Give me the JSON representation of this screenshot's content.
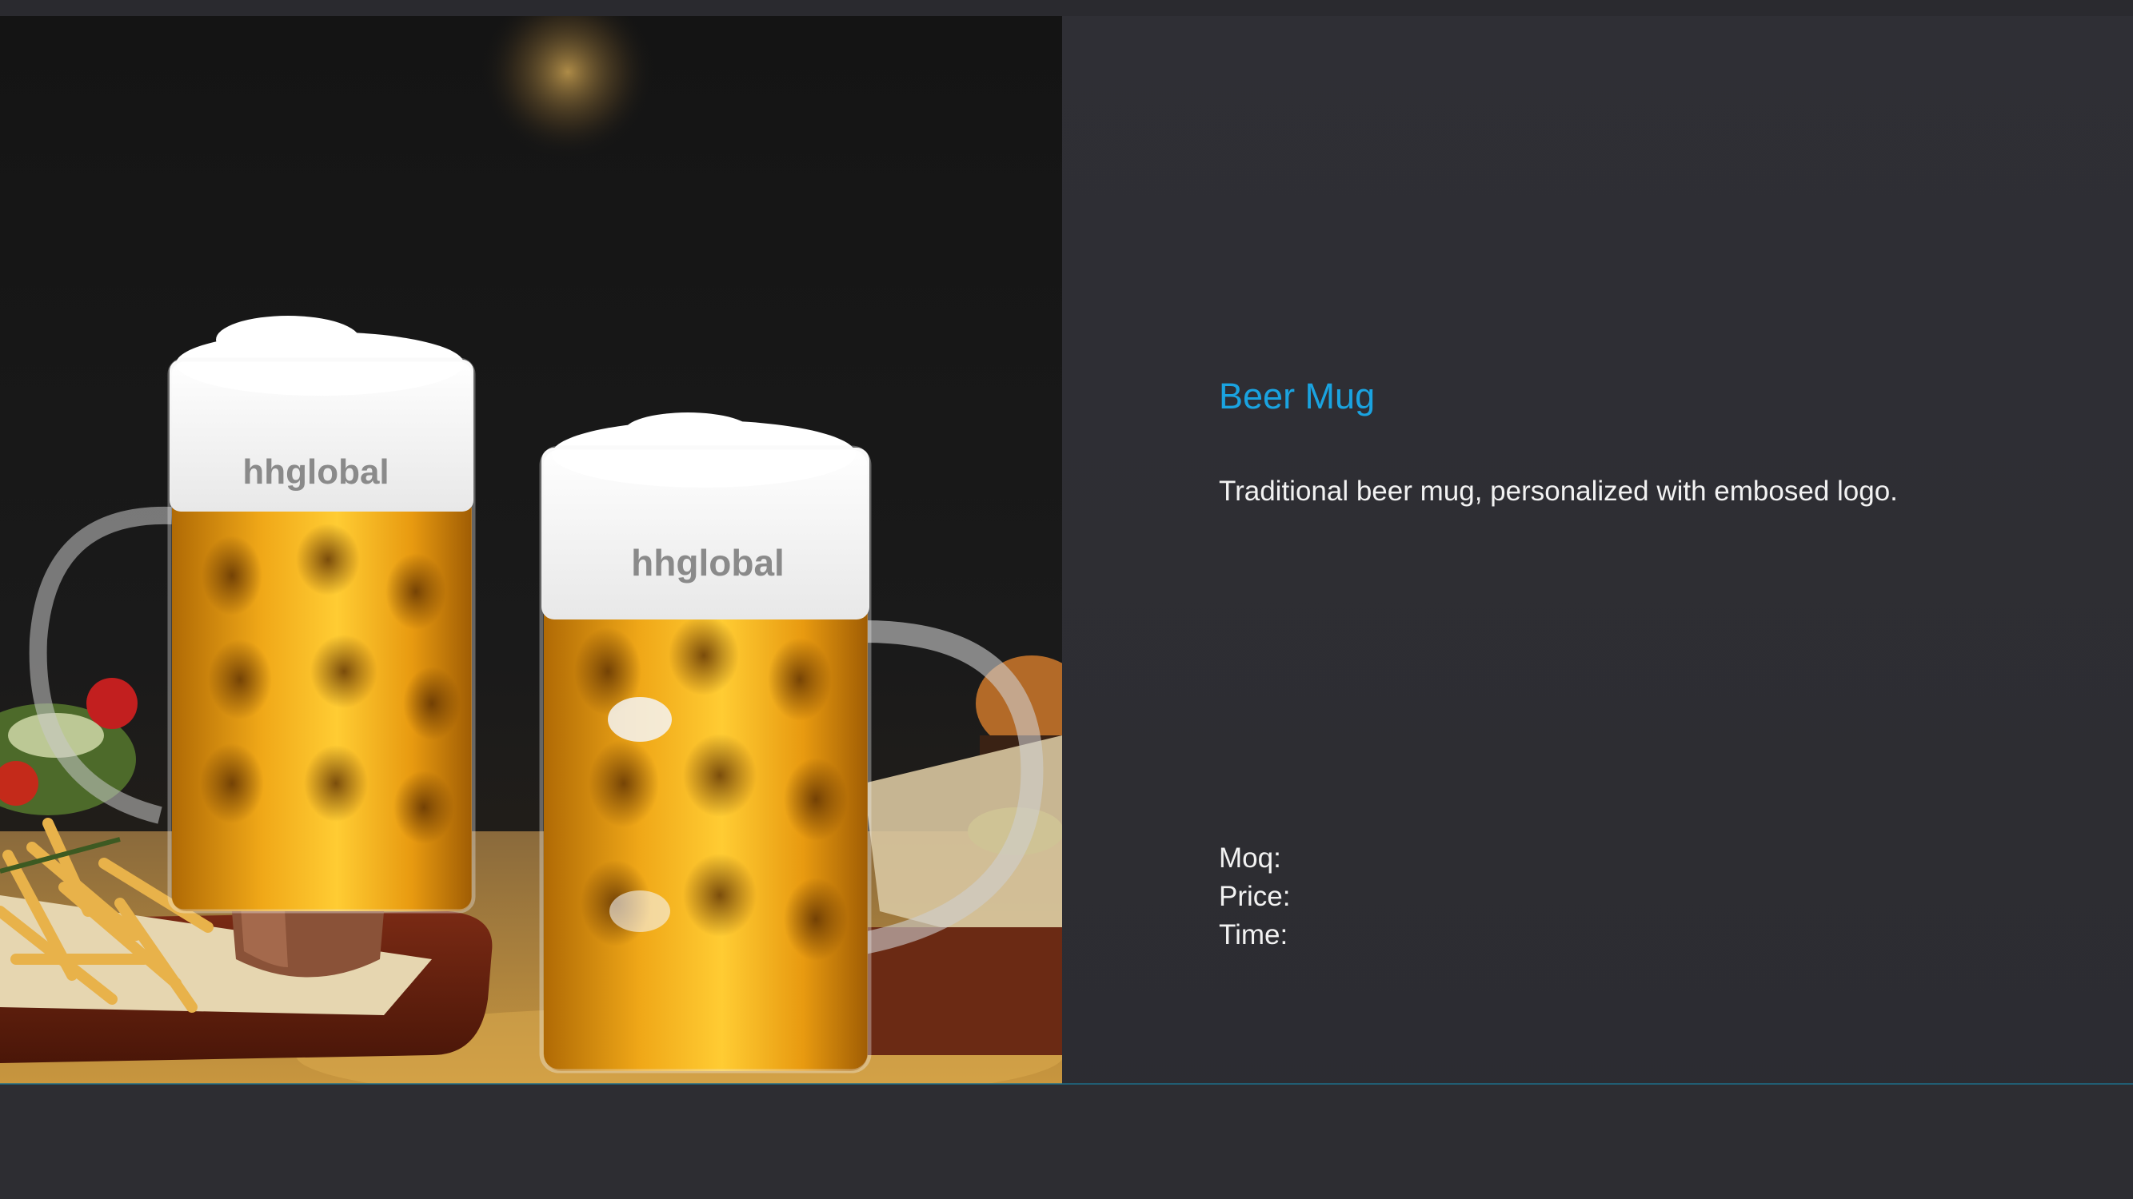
{
  "product": {
    "title": "Beer Mug",
    "description": "Traditional beer mug, personalized with embosed logo.",
    "image_alt": "Two glass beer mugs filled with beer and foam, embossed with hhglobal logo, on a table with fries and burger",
    "logo_text": "hhglobal"
  },
  "specs": {
    "moq_label": "Moq:",
    "price_label": "Price:",
    "time_label": "Time:"
  },
  "colors": {
    "background": "#2e2e33",
    "title": "#1aa3e0",
    "text": "#f2f2f2",
    "accent_line": "#1e6e8a"
  }
}
